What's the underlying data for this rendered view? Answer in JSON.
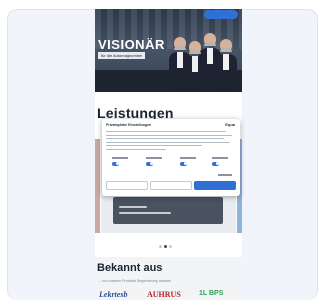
{
  "hero": {
    "title": "VISIONÄR",
    "subtitle": "für die Automagnomiee"
  },
  "sections": {
    "leistungen_heading": "Leistungen",
    "bekannt_heading": "Bekannt aus",
    "bekannt_sub": "... von unseren Produkte Begeisterung machen"
  },
  "logos": [
    "Lekrtesb",
    "AUHRUS",
    "1L BPS"
  ],
  "cookie_modal": {
    "title": "Privatsphäre Einstellungen",
    "brand": "Equa",
    "toggles": [
      "Notwendig",
      "Präferenzen",
      "Statistiken",
      "Marketing"
    ],
    "buttons": [
      "Auswahl erlauben",
      "Nur notwendige",
      "Alle zulassen"
    ]
  },
  "carousel": {
    "count": 3,
    "active": 2
  },
  "colors": {
    "accent": "#2f6fd6",
    "heading": "#1b2432",
    "card_bg": "#f1f5fb"
  }
}
